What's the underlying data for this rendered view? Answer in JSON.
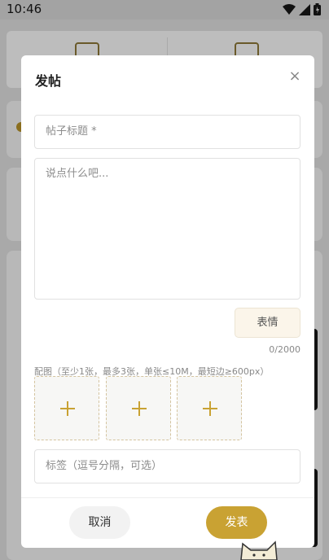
{
  "status_bar": {
    "time": "10:46",
    "icons": [
      "wifi-icon",
      "signal-icon",
      "battery-icon"
    ]
  },
  "dialog": {
    "title": "发帖",
    "close_icon": "×",
    "title_placeholder": "帖子标题 *",
    "content_placeholder": "说点什么吧...",
    "emoji_label": "表情",
    "char_counter": "0/2000",
    "image_hint": "配图（至少1张，最多3张，单张≤10M，最短边≥600px）",
    "image_slots": 3,
    "tags_placeholder": "标签（逗号分隔，可选）",
    "cancel_label": "取消",
    "submit_label": "发表"
  },
  "colors": {
    "accent": "#c9a233",
    "emoji_bg": "#fbf5ea",
    "overlay": "#9a9a9a"
  }
}
